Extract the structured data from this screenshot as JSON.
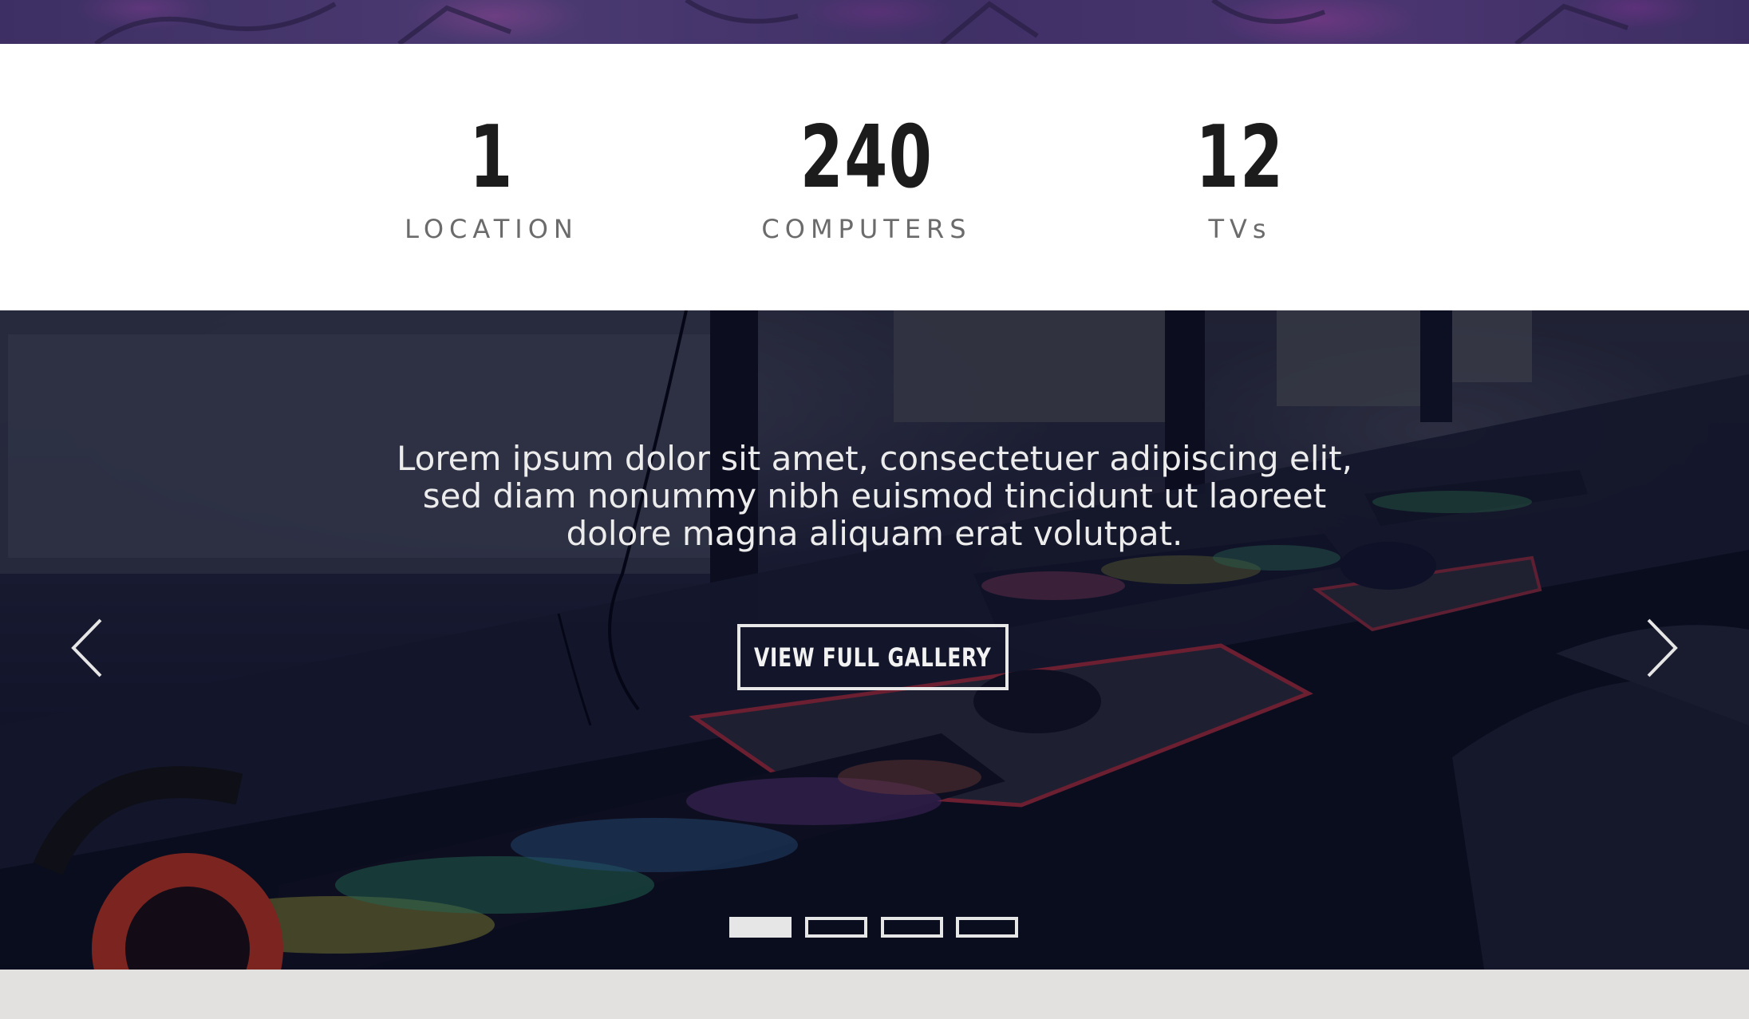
{
  "stats": [
    {
      "number": "1",
      "label": "LOCATION"
    },
    {
      "number": "240",
      "label": "COMPUTERS"
    },
    {
      "number": "12",
      "label": "TVs"
    }
  ],
  "hero": {
    "text": "Lorem ipsum dolor sit amet, consectetuer adipiscing elit, sed diam nonummy nibh euismod tincidunt ut laoreet dolore magna aliquam erat volutpat.",
    "button_label": "VIEW FULL GALLERY",
    "prev_icon": "chevron-left-icon",
    "next_icon": "chevron-right-icon",
    "slides_count": 4,
    "active_slide": 1
  },
  "colors": {
    "top_band": "#3d2f63",
    "stats_bg": "#ffffff",
    "number": "#1c1c1c",
    "label": "#6b6b6b",
    "bottom_band": "#e2e1df"
  }
}
